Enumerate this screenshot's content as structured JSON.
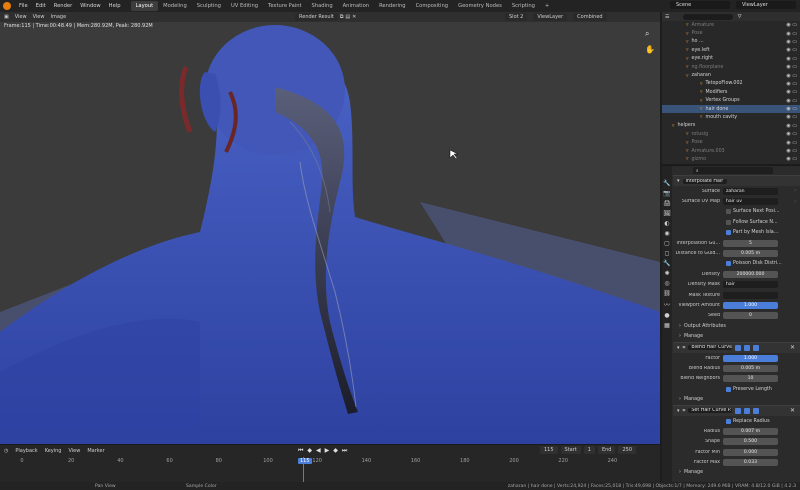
{
  "menu": [
    "File",
    "Edit",
    "Render",
    "Window",
    "Help"
  ],
  "workspaces": [
    "Layout",
    "Modeling",
    "Sculpting",
    "UV Editing",
    "Texture Paint",
    "Shading",
    "Animation",
    "Rendering",
    "Compositing",
    "Geometry Nodes",
    "Scripting"
  ],
  "scene": "Scene",
  "view_layer": "ViewLayer",
  "viewport": {
    "header": [
      "View",
      "View",
      "Image"
    ],
    "info": "Frame:115 | Time:00:48.49 | Mem:280.92M, Peak: 280.92M",
    "render_result": "Render Result",
    "slot": "Slot 2",
    "view_layer": "ViewLayer",
    "combined": "Combined"
  },
  "timeline": {
    "menus": [
      "Playback",
      "Keying",
      "View",
      "Marker"
    ],
    "ticks": [
      "0",
      "20",
      "40",
      "60",
      "80",
      "100",
      "120",
      "140",
      "160",
      "180",
      "200",
      "220",
      "240"
    ],
    "current": "115",
    "start_label": "Start",
    "start": "1",
    "end_label": "End",
    "end": "250"
  },
  "statusbar": {
    "pan": "Pan View",
    "sample": "Sample Color",
    "stats": "zaharan | hair done | Verts:24,924 | Faces:25,018 | Tris:49,698 | Objects:1/7 | Memory: 249.6 MiB | VRAM: 4.8/12.0 GiB | 4.2.3"
  },
  "outliner": [
    {
      "label": "Armature",
      "dim": true,
      "indent": 24
    },
    {
      "label": "Pose",
      "dim": true,
      "indent": 24
    },
    {
      "label": "ho ...",
      "dim": false,
      "indent": 24
    },
    {
      "label": "eye.left",
      "dim": false,
      "indent": 24
    },
    {
      "label": "eye.right",
      "dim": false,
      "indent": 24
    },
    {
      "label": "ng.floorplane",
      "dim": true,
      "indent": 24
    },
    {
      "label": "zaharan",
      "dim": false,
      "indent": 24
    },
    {
      "label": "TetopoFlow.002",
      "dim": false,
      "indent": 38
    },
    {
      "label": "Modifiers",
      "dim": false,
      "indent": 38
    },
    {
      "label": "Vertex Groups",
      "dim": false,
      "indent": 38
    },
    {
      "label": "hair done",
      "dim": false,
      "indent": 38,
      "selected": true
    },
    {
      "label": "mouth cavity",
      "dim": false,
      "indent": 38
    },
    {
      "label": "helpers",
      "dim": false,
      "indent": 10
    },
    {
      "label": "rotusig",
      "dim": true,
      "indent": 24
    },
    {
      "label": "Pose",
      "dim": true,
      "indent": 24
    },
    {
      "label": "Armature.003",
      "dim": true,
      "indent": 24
    },
    {
      "label": "gizmo",
      "dim": true,
      "indent": 24
    }
  ],
  "properties": {
    "top_tab": "Interpolate Hair",
    "surface_label": "Surface",
    "surface": "zaharan",
    "surface_uv_label": "Surface UV Map",
    "surface_uv": "hair uv",
    "surface_next_pos": "Surface Next Posi...",
    "follow_surface": "Follow Surface N...",
    "part_by_mesh": "Part by Mesh Isla...",
    "interp_guides_label": "Interpolation Gu...",
    "interp_guides": "5",
    "dist_guides_label": "Distance to Guid...",
    "dist_guides": "0.005 m",
    "poisson": "Poisson Disk Distri...",
    "density_label": "Density",
    "density": "200000.000",
    "density_mask_label": "Density Mask",
    "density_mask": "hair",
    "mask_texture_label": "Mask Texture",
    "viewport_amount_label": "Viewport Amount",
    "viewport_amount": "1.000",
    "seed_label": "Seed",
    "seed": "0",
    "output_attributes": "Output Attributes",
    "manage1": "Manage",
    "mod2": "Blend Hair Curves",
    "factor_label": "Factor",
    "factor": "1.000",
    "blend_radius_label": "Blend Radius",
    "blend_radius": "0.005 m",
    "blend_neighbors_label": "Blend Neighbors",
    "blend_neighbors": "10",
    "preserve_length": "Preserve Length",
    "manage2": "Manage",
    "mod3": "Set Hair Curve P...",
    "replace_radius": "Replace Radius",
    "radius_label": "Radius",
    "radius": "0.007 m",
    "shape_label": "Shape",
    "shape": "0.500",
    "factor_min_label": "Factor Min",
    "factor_min": "0.000",
    "factor_max_label": "Factor Max",
    "factor_max": "0.033",
    "manage3": "Manage"
  },
  "colors": {
    "accent": "#4a7ed8",
    "skin": "#3d55b4",
    "background": "#3b3b3b"
  }
}
